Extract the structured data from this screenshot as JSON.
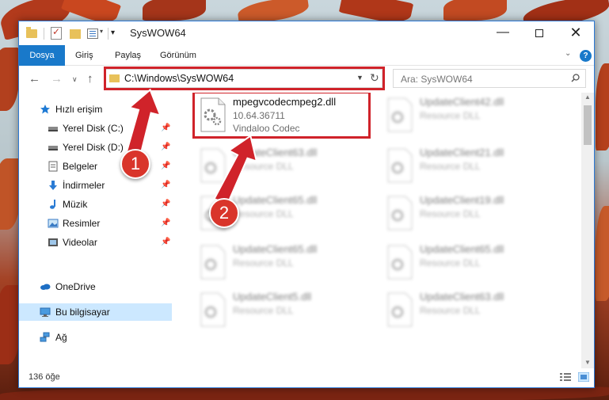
{
  "window": {
    "title": "SysWOW64"
  },
  "ribbon": {
    "tabs": [
      "Dosya",
      "Giriş",
      "Paylaş",
      "Görünüm"
    ],
    "help": "?"
  },
  "address": {
    "path": "C:\\Windows\\SysWOW64",
    "search_placeholder": "Ara: SysWOW64"
  },
  "nav_pane": {
    "quick_access": "Hızlı erişim",
    "items": [
      {
        "label": "Yerel Disk (C:)",
        "icon": "drive-icon",
        "pinned": true
      },
      {
        "label": "Yerel Disk (D:)",
        "icon": "drive-icon",
        "pinned": true
      },
      {
        "label": "Belgeler",
        "icon": "documents-icon",
        "pinned": true
      },
      {
        "label": "İndirmeler",
        "icon": "download-icon",
        "pinned": true
      },
      {
        "label": "Müzik",
        "icon": "music-icon",
        "pinned": true
      },
      {
        "label": "Resimler",
        "icon": "pictures-icon",
        "pinned": true
      },
      {
        "label": "Videolar",
        "icon": "video-icon",
        "pinned": true
      }
    ],
    "onedrive": "OneDrive",
    "this_pc": "Bu bilgisayar",
    "network": "Ağ"
  },
  "files": [
    {
      "name": "mpegvcodecmpeg2.dll",
      "version": "10.64.36711",
      "desc": "Vindaloo Codec",
      "highlighted": true
    },
    {
      "name": "UpdateClient42.dll",
      "desc": "Resource DLL"
    },
    {
      "name": "UpdateClient63.dll",
      "desc": "Resource DLL"
    },
    {
      "name": "UpdateClient21.dll",
      "desc": "Resource DLL"
    },
    {
      "name": "UpdateClient65.dll",
      "desc": "Resource DLL"
    },
    {
      "name": "UpdateClient19.dll",
      "desc": "Resource DLL"
    },
    {
      "name": "UpdateClient65.dll",
      "desc": "Resource DLL"
    },
    {
      "name": "UpdateClient65.dll",
      "desc": "Resource DLL"
    },
    {
      "name": "UpdateClient5.dll",
      "desc": "Resource DLL"
    },
    {
      "name": "UpdateClient63.dll",
      "desc": "Resource DLL"
    }
  ],
  "status": {
    "count": "136 öğe"
  },
  "annotations": {
    "step1": "1",
    "step2": "2",
    "color": "#d0232a"
  }
}
